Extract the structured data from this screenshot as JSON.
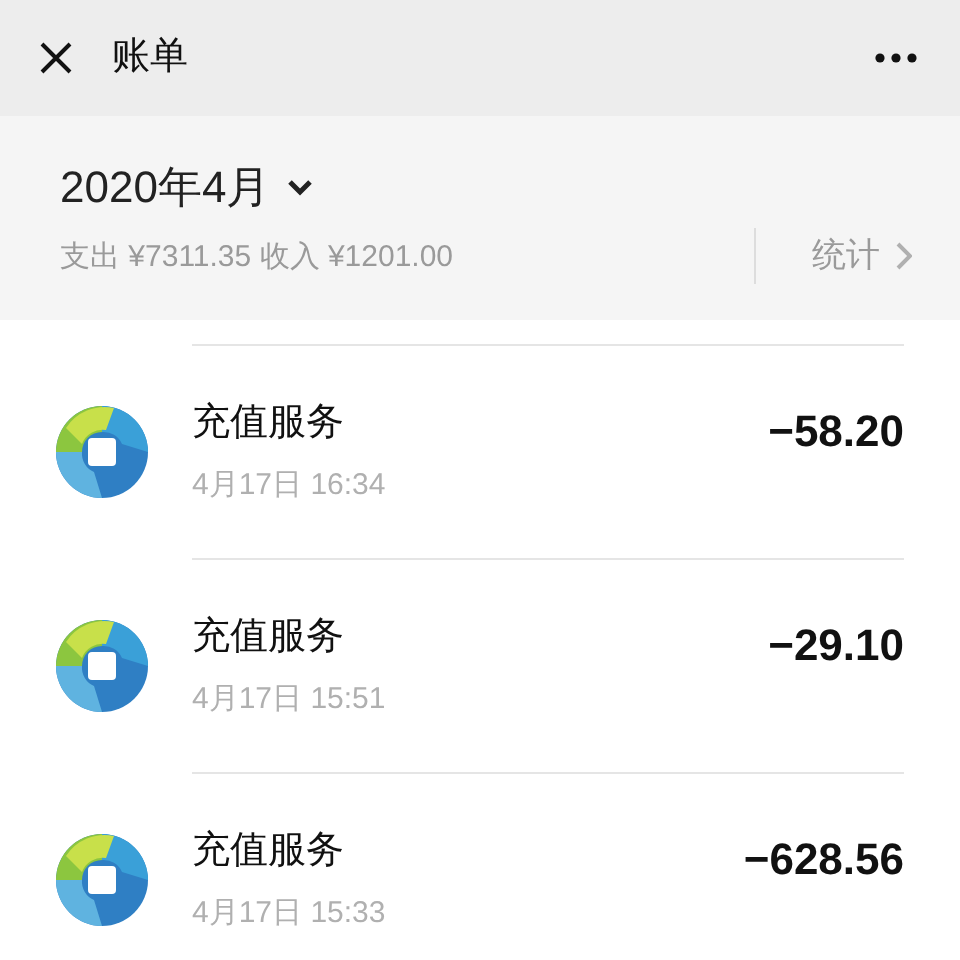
{
  "header": {
    "title": "账单"
  },
  "summary": {
    "month": "2020年4月",
    "totals": "支出 ¥7311.35 收入 ¥1201.00",
    "stats_link": "统计"
  },
  "bills": [
    {
      "name": "充值服务",
      "time": "4月17日 16:34",
      "amount": "−58.20"
    },
    {
      "name": "充值服务",
      "time": "4月17日 15:51",
      "amount": "−29.10"
    },
    {
      "name": "充值服务",
      "time": "4月17日 15:33",
      "amount": "−628.56"
    }
  ]
}
